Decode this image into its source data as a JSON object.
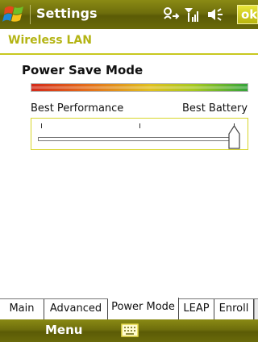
{
  "titlebar": {
    "title": "Settings",
    "ok_label": "ok",
    "icons": [
      "windows-start-icon",
      "connectivity-icon",
      "signal-strength-icon",
      "speaker-icon"
    ]
  },
  "section": {
    "title": "Wireless LAN"
  },
  "power_save": {
    "heading": "Power Save Mode",
    "left_label": "Best Performance",
    "right_label": "Best Battery",
    "slider_level": 1.0,
    "slider_steps": 3
  },
  "tabs": [
    {
      "label": "Main"
    },
    {
      "label": "Advanced"
    },
    {
      "label": "Power Mode",
      "active": true
    },
    {
      "label": "LEAP"
    },
    {
      "label": "Enroll"
    }
  ],
  "menubar": {
    "menu_label": "Menu",
    "keyboard_icon": "keyboard-icon"
  },
  "colors": {
    "bar": "#6e6e0c",
    "accent": "#c8c820",
    "section_text": "#b4b414"
  }
}
